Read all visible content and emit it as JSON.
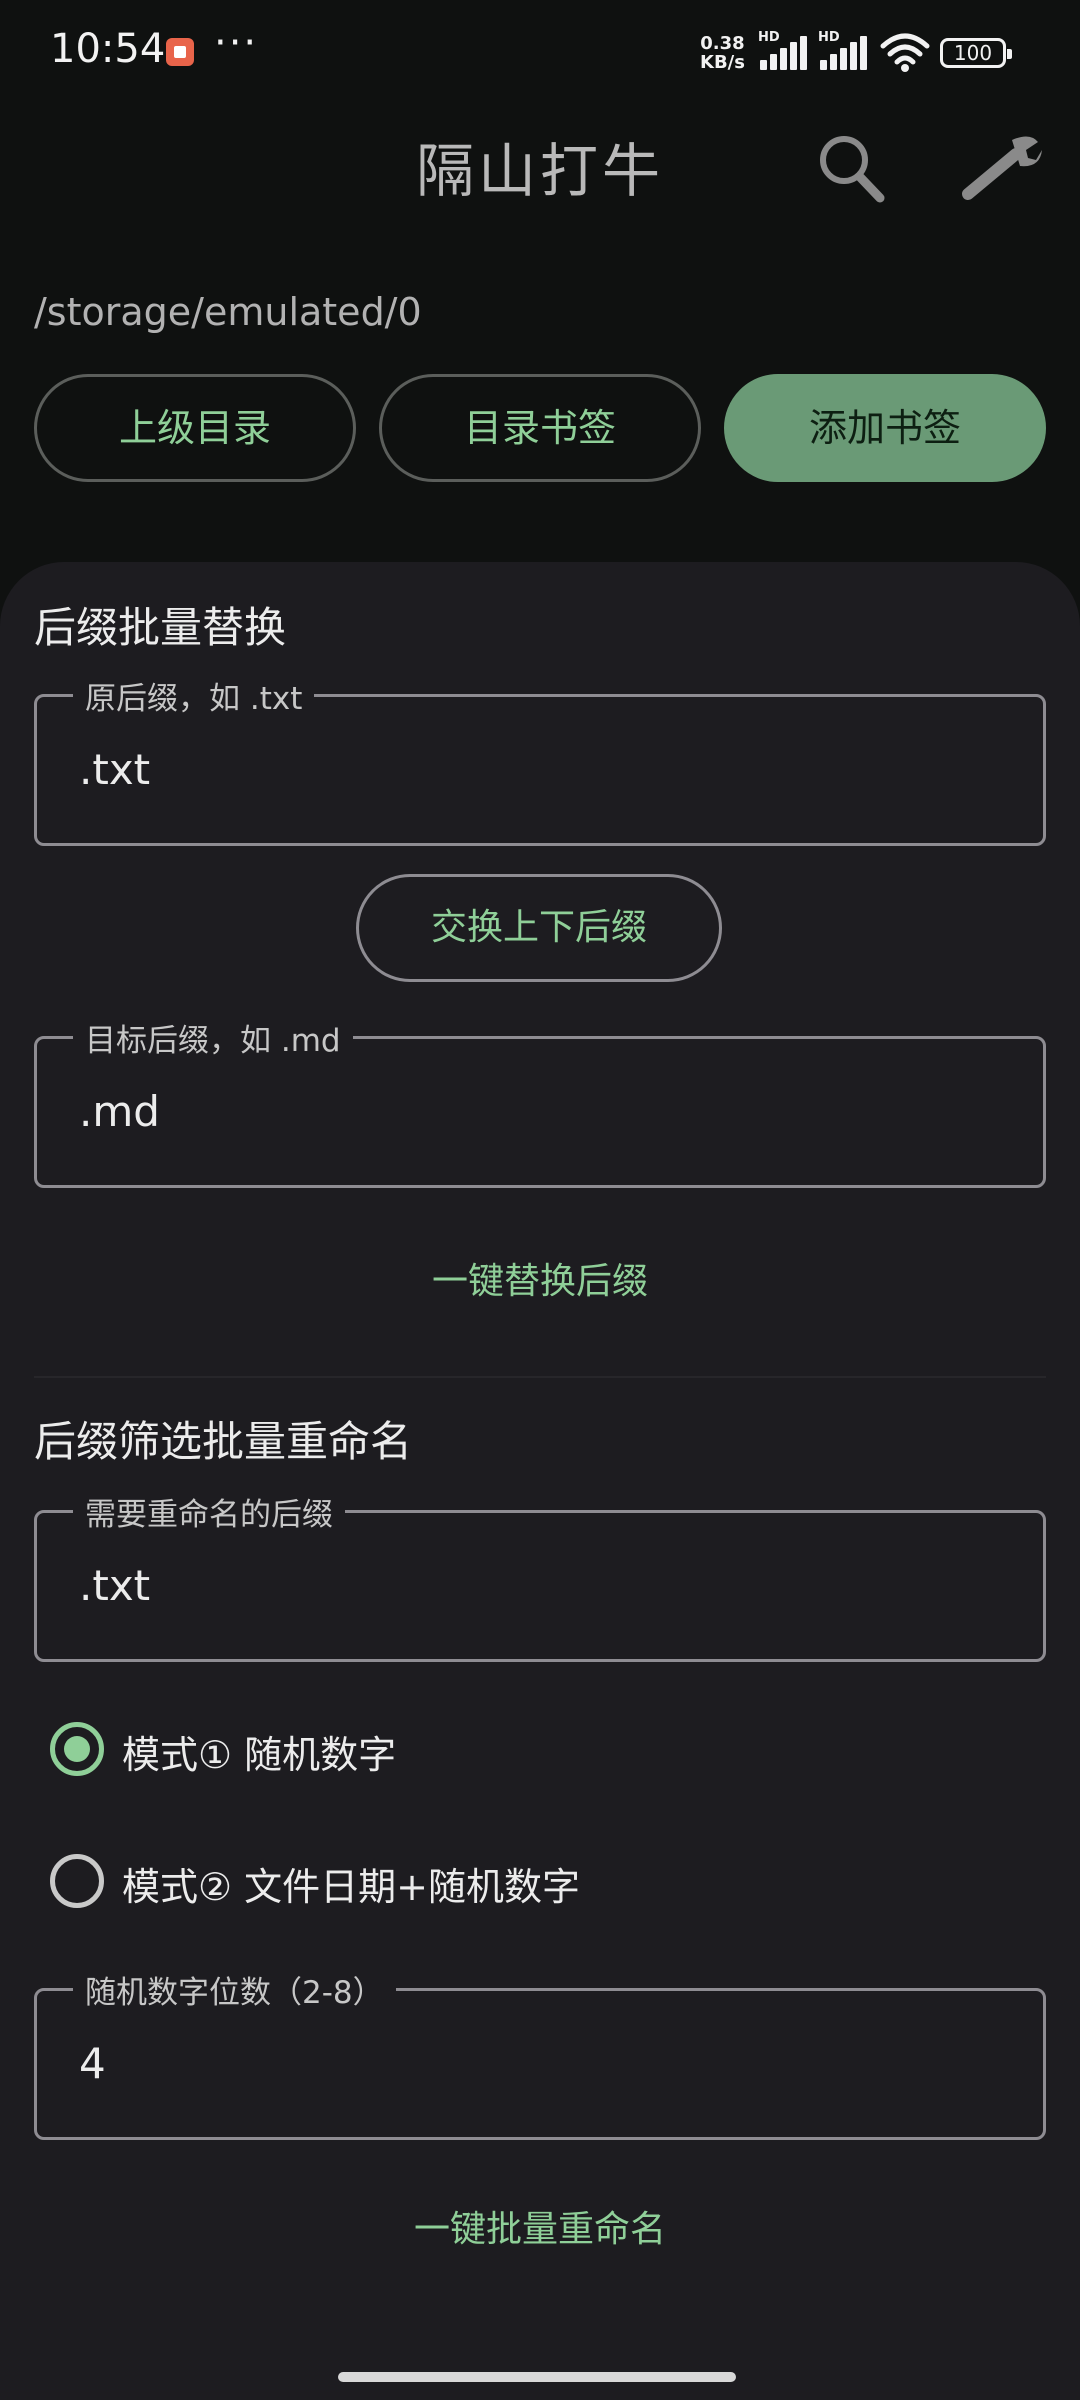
{
  "status_bar": {
    "time": "10:54",
    "dots": "···",
    "speed_value": "0.38",
    "speed_unit": "KB/s",
    "hd1": "HD",
    "hd2": "HD",
    "battery": "100",
    "icons": [
      "notification-app-icon",
      "signal-icon",
      "signal-icon",
      "wifi-icon",
      "battery-icon"
    ]
  },
  "app_bar": {
    "title": "隔山打牛",
    "actions": [
      "search-icon",
      "wrench-icon"
    ]
  },
  "path": "/storage/emulated/0",
  "nav_buttons": {
    "parent": "上级目录",
    "bookmarks": "目录书签",
    "add_bookmark": "添加书签"
  },
  "suffix_replace": {
    "title": "后缀批量替换",
    "source_label": "原后缀，如 .txt",
    "source_value": ".txt",
    "swap_button": "交换上下后缀",
    "target_label": "目标后缀，如 .md",
    "target_value": ".md",
    "action_button": "一键替换后缀"
  },
  "suffix_rename": {
    "title": "后缀筛选批量重命名",
    "suffix_label": "需要重命名的后缀",
    "suffix_value": ".txt",
    "modes": [
      {
        "label": "模式① 随机数字",
        "selected": true
      },
      {
        "label": "模式② 文件日期+随机数字",
        "selected": false
      }
    ],
    "digits_label": "随机数字位数（2-8）",
    "digits_value": "4",
    "action_button": "一键批量重命名"
  },
  "colors": {
    "accent": "#8fcf98",
    "accent_fill": "#6a9a76",
    "sheet_bg": "#1d1c20",
    "page_bg": "#0f1110"
  }
}
